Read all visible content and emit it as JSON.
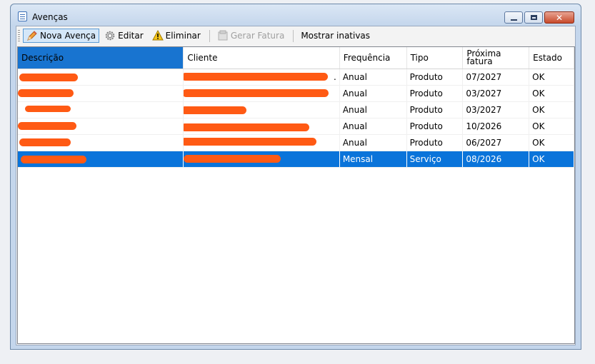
{
  "window": {
    "title": "Avenças",
    "close_glyph": "✕"
  },
  "toolbar": {
    "items": [
      {
        "label": "Nova Avença",
        "icon": "pencil-icon"
      },
      {
        "label": "Editar",
        "icon": "gear-icon"
      },
      {
        "label": "Eliminar",
        "icon": "warning-icon"
      },
      {
        "label": "Gerar Fatura",
        "icon": "invoice-icon"
      },
      {
        "label": "Mostrar inativas"
      }
    ]
  },
  "columns": [
    "Descrição",
    "Cliente",
    "Frequência",
    "Tipo",
    "Próxima fatura",
    "Estado"
  ],
  "rows": [
    {
      "descricao": "",
      "cliente": ".",
      "frequencia": "Anual",
      "tipo": "Produto",
      "proxima": "07/2027",
      "estado": "OK"
    },
    {
      "descricao": "",
      "cliente": "",
      "frequencia": "Anual",
      "tipo": "Produto",
      "proxima": "03/2027",
      "estado": "OK"
    },
    {
      "descricao": "",
      "cliente": "",
      "frequencia": "Anual",
      "tipo": "Produto",
      "proxima": "03/2027",
      "estado": "OK"
    },
    {
      "descricao": "",
      "cliente": "",
      "frequencia": "Anual",
      "tipo": "Produto",
      "proxima": "10/2026",
      "estado": "OK"
    },
    {
      "descricao": "",
      "cliente": "",
      "frequencia": "Anual",
      "tipo": "Produto",
      "proxima": "06/2027",
      "estado": "OK"
    },
    {
      "descricao": "",
      "cliente": "",
      "frequencia": "Mensal",
      "tipo": "Serviço",
      "proxima": "08/2026",
      "estado": "OK"
    }
  ],
  "colors": {
    "selection": "#0a74da",
    "redaction": "#ff5a14",
    "header_selected": "#1874d0"
  }
}
